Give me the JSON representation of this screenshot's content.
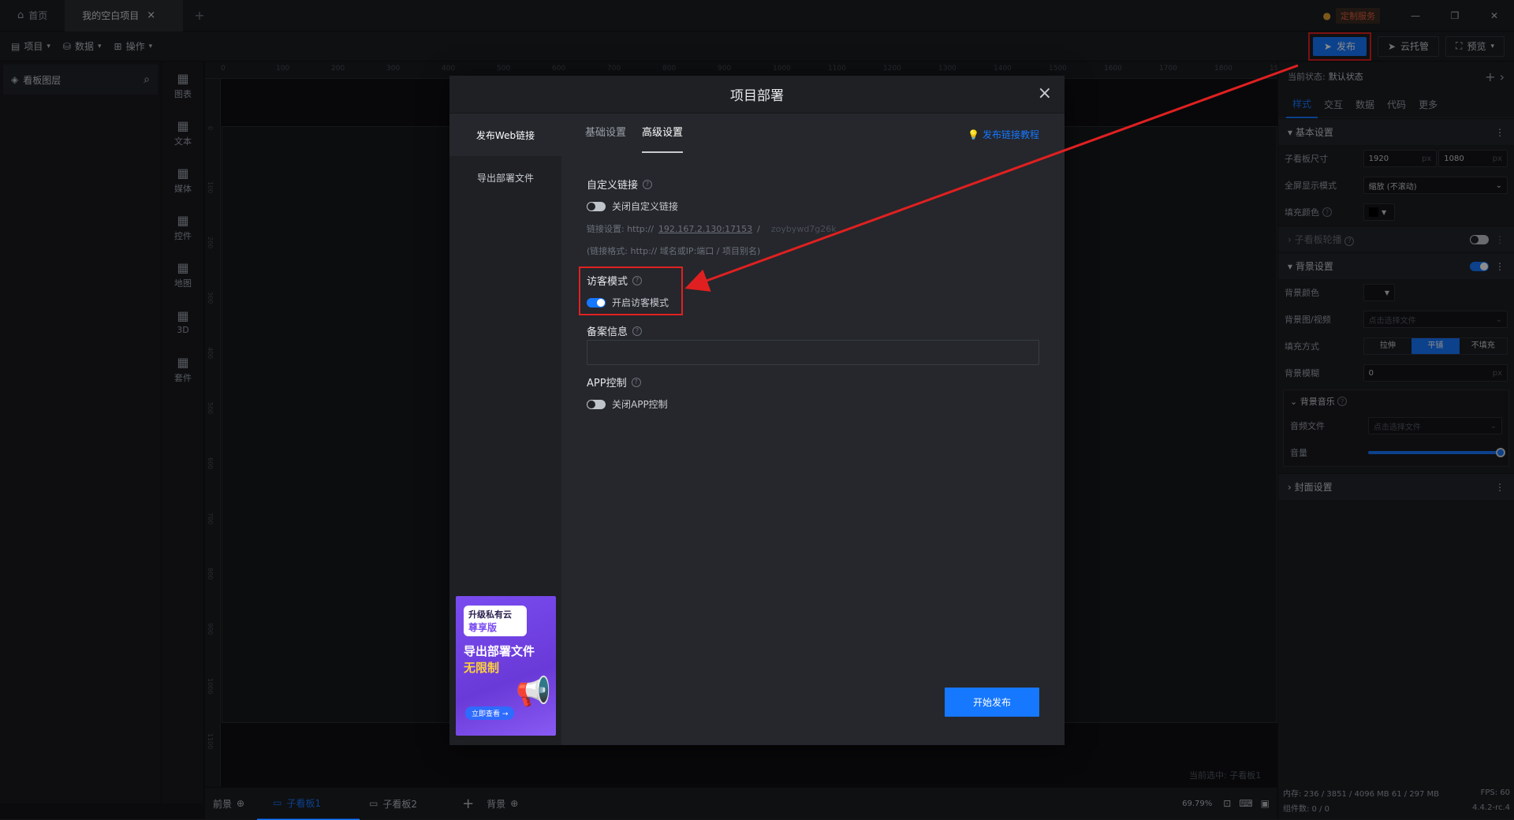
{
  "titlebar": {
    "home_tab": "首页",
    "project_tab": "我的空白项目",
    "close_tab": "×",
    "add_tab": "+",
    "custom_service": "定制服务",
    "win_min": "—",
    "win_restore": "❐",
    "win_close": "✕"
  },
  "toolbar": {
    "menu_project": "项目",
    "menu_data": "数据",
    "menu_operation": "操作",
    "publish": "发布",
    "cloud_host": "云托管",
    "preview": "预览"
  },
  "layers": {
    "title": "看板图层"
  },
  "components": [
    {
      "label": "图表",
      "icon": "chart-icon"
    },
    {
      "label": "文本",
      "icon": "text-icon"
    },
    {
      "label": "媒体",
      "icon": "media-icon"
    },
    {
      "label": "控件",
      "icon": "widget-icon"
    },
    {
      "label": "地图",
      "icon": "map-icon"
    },
    {
      "label": "3D",
      "icon": "cube-icon"
    },
    {
      "label": "套件",
      "icon": "kit-icon"
    }
  ],
  "ruler": {
    "top_ticks": [
      "0",
      "100",
      "200",
      "300",
      "400",
      "500",
      "600",
      "700",
      "800",
      "900",
      "1000",
      "1100",
      "1200",
      "1300",
      "1400",
      "1500",
      "1600",
      "1700",
      "1800",
      "1900"
    ],
    "left_ticks": [
      "0",
      "100",
      "200",
      "300",
      "400",
      "500",
      "600",
      "700",
      "800",
      "900",
      "1000",
      "1100"
    ]
  },
  "canvas": {
    "current_selection": "当前选中: 子看板1"
  },
  "bottombar": {
    "foreground": "前景",
    "board1": "子看板1",
    "board2": "子看板2",
    "add": "+",
    "background": "背景",
    "zoom": "69.79%"
  },
  "rightpanel": {
    "current_state_label": "当前状态:",
    "current_state_value": "默认状态",
    "tabs": [
      "样式",
      "交互",
      "数据",
      "代码",
      "更多"
    ],
    "basic_settings": "基本设置",
    "board_size_label": "子看板尺寸",
    "width": "1920",
    "height": "1080",
    "unit": "px",
    "fullscreen_label": "全屏显示模式",
    "fullscreen_value": "缩放 (不滚动)",
    "fill_color_label": "填充颜色",
    "carousel": "子看板轮播",
    "bg_settings": "背景设置",
    "bg_color_label": "背景颜色",
    "bg_image_label": "背景图/视频",
    "bg_image_placeholder": "点击选择文件",
    "fill_mode_label": "填充方式",
    "fill_modes": [
      "拉伸",
      "平铺",
      "不填充"
    ],
    "bg_blur_label": "背景模糊",
    "bg_blur_value": "0",
    "bg_music": "背景音乐",
    "audio_file_label": "音频文件",
    "audio_file_placeholder": "点击选择文件",
    "volume_label": "音量",
    "volume_fraction": 1.0,
    "cover_settings": "封面设置",
    "memory": "内存: 236 / 3851 / 4096 MB  61 / 297 MB",
    "fps": "FPS: 60",
    "components_count": "组件数: 0 / 0",
    "version": "4.4.2-rc.4"
  },
  "modal": {
    "title": "项目部署",
    "close": "×",
    "side_items": [
      "发布Web链接",
      "导出部署文件"
    ],
    "tabs": [
      "基础设置",
      "高级设置"
    ],
    "tutorial_link": "发布链接教程",
    "custom_link_label": "自定义链接",
    "custom_link_switch": "关闭自定义链接",
    "link_setting_prefix": "链接设置: http://",
    "link_host": "192.167.2.130:17153",
    "link_slash": "/",
    "link_alias_placeholder": "zoybywd7g26k",
    "link_format": "(链接格式: http:// 域名或IP:端口 / 项目别名)",
    "guest_mode_label": "访客模式",
    "guest_mode_switch": "开启访客模式",
    "icp_label": "备案信息",
    "app_control_label": "APP控制",
    "app_control_switch": "关闭APP控制",
    "publish_button": "开始发布",
    "ad": {
      "tag_line1": "升级私有云",
      "tag_line2": "尊享版",
      "headline": "导出部署文件",
      "subheadline": "无限制",
      "cta": "立即查看 →"
    }
  },
  "colors": {
    "accent": "#1677ff",
    "annotation": "#e02020",
    "modal_bg": "#25272c"
  }
}
